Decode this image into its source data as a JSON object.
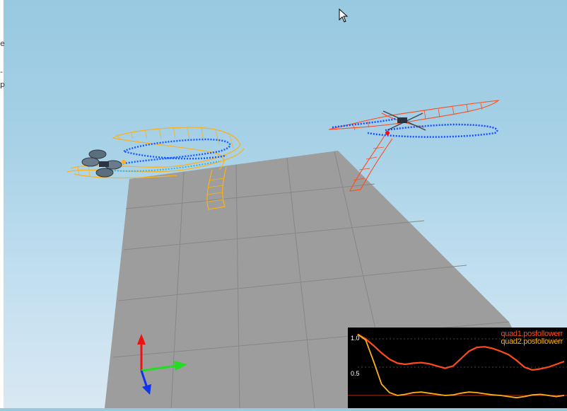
{
  "sidebar": {
    "fragments": [
      "e",
      "-",
      "p"
    ]
  },
  "colors": {
    "quad1": "#ff4a1a",
    "quad2": "#ffb015",
    "trajectory_dots": "#1a4dff",
    "floor": "#9d9d9d",
    "grid": "#8a8a8a",
    "axis_x": "#22dd22",
    "axis_y": "#ee1111",
    "axis_z": "#1133ee"
  },
  "icons": {
    "cursor": "mouse-pointer-icon",
    "axes": "xyz-axes-gizmo-icon"
  },
  "plot": {
    "legend": [
      {
        "label": "quad1.posfollowerr",
        "color": "#ff4a1a"
      },
      {
        "label": "quad2.posfollowerr",
        "color": "#ffb015"
      }
    ],
    "ticks": [
      "1.0",
      "0.5"
    ]
  },
  "chart_data": {
    "type": "line",
    "ylim": [
      0,
      1.1
    ],
    "series": [
      {
        "name": "quad1.posfollowerr",
        "values": [
          1.08,
          1.0,
          0.88,
          0.75,
          0.64,
          0.57,
          0.55,
          0.57,
          0.58,
          0.56,
          0.52,
          0.48,
          0.52,
          0.65,
          0.78,
          0.85,
          0.86,
          0.83,
          0.78,
          0.72,
          0.62,
          0.5,
          0.45,
          0.47,
          0.5,
          0.55,
          0.6
        ]
      },
      {
        "name": "quad2.posfollowerr",
        "values": [
          1.08,
          0.98,
          0.6,
          0.2,
          0.05,
          0.0,
          0.02,
          0.05,
          0.06,
          0.04,
          0.02,
          0.0,
          0.01,
          0.04,
          0.06,
          0.05,
          0.03,
          0.01,
          0.0,
          -0.02,
          -0.04,
          -0.02,
          0.01,
          0.02,
          0.0,
          -0.02,
          0.0
        ]
      }
    ],
    "threshold": 0.0
  }
}
